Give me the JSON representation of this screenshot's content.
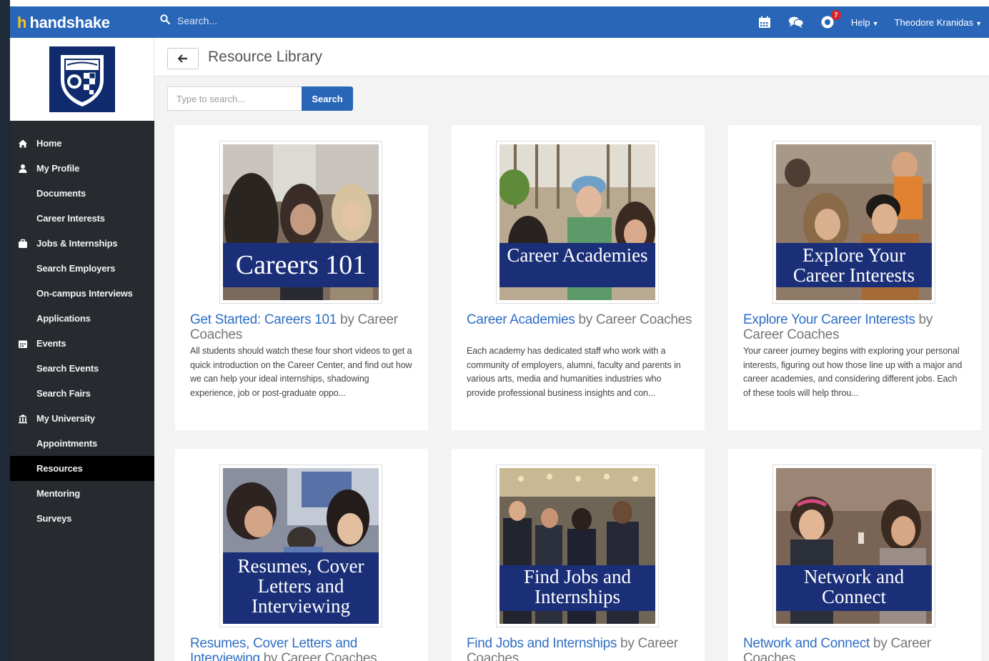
{
  "brand": {
    "name": "handshake"
  },
  "topbar": {
    "search_placeholder": "Search...",
    "badge_count": "7",
    "help_label": "Help",
    "user_name": "Theodore Kranidas",
    "accent": "#2966b8"
  },
  "sidebar": {
    "items": [
      {
        "label": "Home",
        "icon": "home-icon",
        "section": true
      },
      {
        "label": "My Profile",
        "icon": "user-icon",
        "section": true
      },
      {
        "label": "Documents",
        "section": false
      },
      {
        "label": "Career Interests",
        "section": false
      },
      {
        "label": "Jobs & Internships",
        "icon": "briefcase-icon",
        "section": true
      },
      {
        "label": "Search Employers",
        "section": false
      },
      {
        "label": "On-campus Interviews",
        "section": false
      },
      {
        "label": "Applications",
        "section": false
      },
      {
        "label": "Events",
        "icon": "calendar-icon",
        "section": true
      },
      {
        "label": "Search Events",
        "section": false
      },
      {
        "label": "Search Fairs",
        "section": false
      },
      {
        "label": "My University",
        "icon": "university-icon",
        "section": true
      },
      {
        "label": "Appointments",
        "section": false
      },
      {
        "label": "Resources",
        "section": false,
        "active": true
      },
      {
        "label": "Mentoring",
        "section": false
      },
      {
        "label": "Surveys",
        "section": false
      }
    ]
  },
  "main": {
    "title": "Resource Library",
    "search": {
      "placeholder": "Type to search...",
      "button_label": "Search"
    },
    "cards": [
      {
        "banner": "Careers 101",
        "title_link": "Get Started: Careers 101",
        "title_rest": " by Career Coaches",
        "description": "All students should watch these four short videos to get a quick introduction on the Career Center, and find out how we can help your ideal internships, shadowing experience, job or post-graduate oppo..."
      },
      {
        "banner": "Career Academies",
        "title_link": "Career Academies",
        "title_rest": " by Career Coaches",
        "description": "Each academy has dedicated staff who work with a community of employers, alumni, faculty and parents in various arts, media and humanities industries who provide professional business insights and con..."
      },
      {
        "banner": "Explore Your Career Interests",
        "title_link": "Explore Your Career Interests",
        "title_rest": " by Career Coaches",
        "description": "Your career journey begins with exploring your personal interests, figuring out how those line up with a major and career academies, and considering different jobs. Each of these tools will help throu..."
      },
      {
        "banner": "Resumes, Cover Letters and Interviewing",
        "title_link": "Resumes, Cover Letters and Interviewing",
        "title_rest": " by Career Coaches",
        "description": ""
      },
      {
        "banner": "Find Jobs and Internships",
        "title_link": "Find Jobs and Internships",
        "title_rest": " by Career Coaches",
        "description": ""
      },
      {
        "banner": "Network and Connect",
        "title_link": "Network and Connect",
        "title_rest": " by Career Coaches",
        "description": ""
      }
    ]
  }
}
